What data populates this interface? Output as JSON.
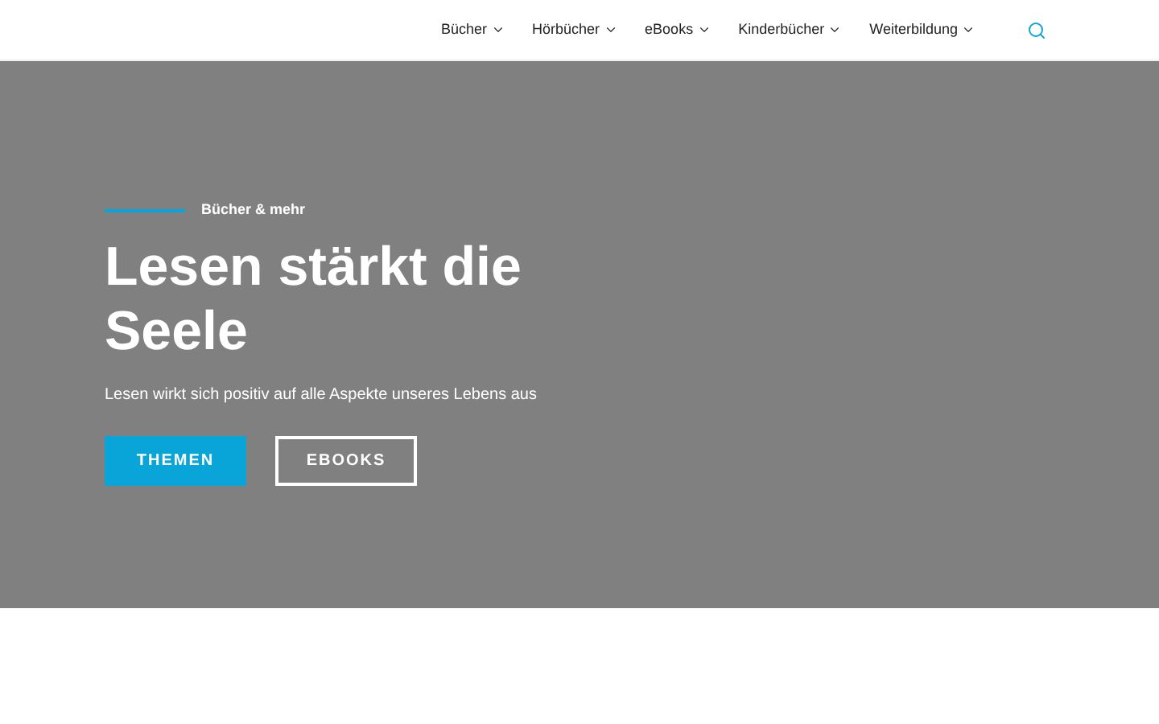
{
  "nav": {
    "items": [
      {
        "label": "Bücher"
      },
      {
        "label": "Hörbücher"
      },
      {
        "label": "eBooks"
      },
      {
        "label": "Kinderbücher"
      },
      {
        "label": "Weiterbildung"
      }
    ]
  },
  "hero": {
    "eyebrow": "Bücher & mehr",
    "title": "Lesen stärkt die Seele",
    "subtitle": "Lesen wirkt sich positiv auf alle Aspekte unseres Lebens aus",
    "buttons": [
      {
        "label": "THEMEN",
        "kind": "primary"
      },
      {
        "label": "EBOOKS",
        "kind": "outline"
      }
    ]
  }
}
